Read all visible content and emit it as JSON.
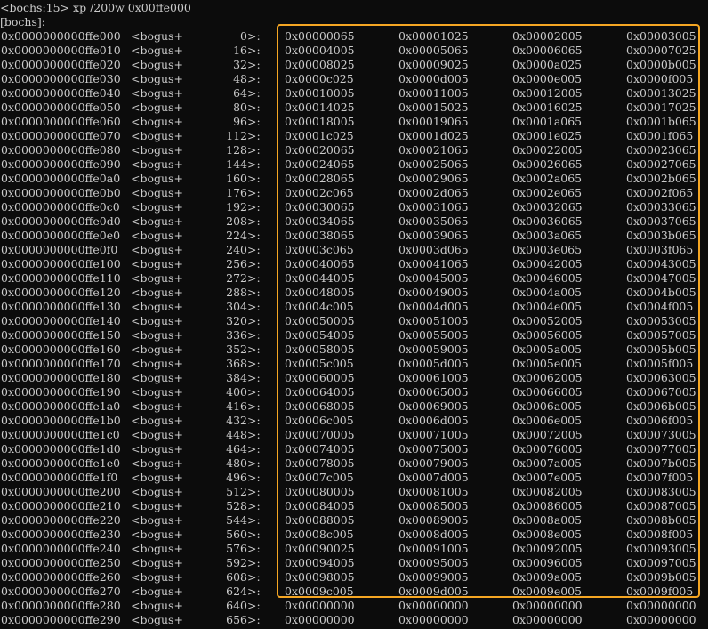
{
  "terminal": {
    "command_line": "<bochs:15> xp /200w 0x00ffe000",
    "prompt_line": "[bochs]:",
    "highlight_color": "#f5a623",
    "text_color": "#cccccc",
    "background_color": "#0c0c0c"
  },
  "rows": [
    {
      "addr": "0x0000000000ffe000",
      "sym": "<bogus+",
      "off": "0",
      "vals": [
        "0x00000065",
        "0x00001025",
        "0x00002005",
        "0x00003005"
      ]
    },
    {
      "addr": "0x0000000000ffe010",
      "sym": "<bogus+",
      "off": "16",
      "vals": [
        "0x00004005",
        "0x00005065",
        "0x00006065",
        "0x00007025"
      ]
    },
    {
      "addr": "0x0000000000ffe020",
      "sym": "<bogus+",
      "off": "32",
      "vals": [
        "0x00008025",
        "0x00009025",
        "0x0000a025",
        "0x0000b005"
      ]
    },
    {
      "addr": "0x0000000000ffe030",
      "sym": "<bogus+",
      "off": "48",
      "vals": [
        "0x0000c025",
        "0x0000d005",
        "0x0000e005",
        "0x0000f005"
      ]
    },
    {
      "addr": "0x0000000000ffe040",
      "sym": "<bogus+",
      "off": "64",
      "vals": [
        "0x00010005",
        "0x00011005",
        "0x00012005",
        "0x00013025"
      ]
    },
    {
      "addr": "0x0000000000ffe050",
      "sym": "<bogus+",
      "off": "80",
      "vals": [
        "0x00014025",
        "0x00015025",
        "0x00016025",
        "0x00017025"
      ]
    },
    {
      "addr": "0x0000000000ffe060",
      "sym": "<bogus+",
      "off": "96",
      "vals": [
        "0x00018005",
        "0x00019065",
        "0x0001a065",
        "0x0001b065"
      ]
    },
    {
      "addr": "0x0000000000ffe070",
      "sym": "<bogus+",
      "off": "112",
      "vals": [
        "0x0001c025",
        "0x0001d025",
        "0x0001e025",
        "0x0001f065"
      ]
    },
    {
      "addr": "0x0000000000ffe080",
      "sym": "<bogus+",
      "off": "128",
      "vals": [
        "0x00020065",
        "0x00021065",
        "0x00022005",
        "0x00023065"
      ]
    },
    {
      "addr": "0x0000000000ffe090",
      "sym": "<bogus+",
      "off": "144",
      "vals": [
        "0x00024065",
        "0x00025065",
        "0x00026065",
        "0x00027065"
      ]
    },
    {
      "addr": "0x0000000000ffe0a0",
      "sym": "<bogus+",
      "off": "160",
      "vals": [
        "0x00028065",
        "0x00029065",
        "0x0002a065",
        "0x0002b065"
      ]
    },
    {
      "addr": "0x0000000000ffe0b0",
      "sym": "<bogus+",
      "off": "176",
      "vals": [
        "0x0002c065",
        "0x0002d065",
        "0x0002e065",
        "0x0002f065"
      ]
    },
    {
      "addr": "0x0000000000ffe0c0",
      "sym": "<bogus+",
      "off": "192",
      "vals": [
        "0x00030065",
        "0x00031065",
        "0x00032065",
        "0x00033065"
      ]
    },
    {
      "addr": "0x0000000000ffe0d0",
      "sym": "<bogus+",
      "off": "208",
      "vals": [
        "0x00034065",
        "0x00035065",
        "0x00036065",
        "0x00037065"
      ]
    },
    {
      "addr": "0x0000000000ffe0e0",
      "sym": "<bogus+",
      "off": "224",
      "vals": [
        "0x00038065",
        "0x00039065",
        "0x0003a065",
        "0x0003b065"
      ]
    },
    {
      "addr": "0x0000000000ffe0f0",
      "sym": "<bogus+",
      "off": "240",
      "vals": [
        "0x0003c065",
        "0x0003d065",
        "0x0003e065",
        "0x0003f065"
      ]
    },
    {
      "addr": "0x0000000000ffe100",
      "sym": "<bogus+",
      "off": "256",
      "vals": [
        "0x00040065",
        "0x00041065",
        "0x00042005",
        "0x00043005"
      ]
    },
    {
      "addr": "0x0000000000ffe110",
      "sym": "<bogus+",
      "off": "272",
      "vals": [
        "0x00044005",
        "0x00045005",
        "0x00046005",
        "0x00047005"
      ]
    },
    {
      "addr": "0x0000000000ffe120",
      "sym": "<bogus+",
      "off": "288",
      "vals": [
        "0x00048005",
        "0x00049005",
        "0x0004a005",
        "0x0004b005"
      ]
    },
    {
      "addr": "0x0000000000ffe130",
      "sym": "<bogus+",
      "off": "304",
      "vals": [
        "0x0004c005",
        "0x0004d005",
        "0x0004e005",
        "0x0004f005"
      ]
    },
    {
      "addr": "0x0000000000ffe140",
      "sym": "<bogus+",
      "off": "320",
      "vals": [
        "0x00050005",
        "0x00051005",
        "0x00052005",
        "0x00053005"
      ]
    },
    {
      "addr": "0x0000000000ffe150",
      "sym": "<bogus+",
      "off": "336",
      "vals": [
        "0x00054005",
        "0x00055005",
        "0x00056005",
        "0x00057005"
      ]
    },
    {
      "addr": "0x0000000000ffe160",
      "sym": "<bogus+",
      "off": "352",
      "vals": [
        "0x00058005",
        "0x00059005",
        "0x0005a005",
        "0x0005b005"
      ]
    },
    {
      "addr": "0x0000000000ffe170",
      "sym": "<bogus+",
      "off": "368",
      "vals": [
        "0x0005c005",
        "0x0005d005",
        "0x0005e005",
        "0x0005f005"
      ]
    },
    {
      "addr": "0x0000000000ffe180",
      "sym": "<bogus+",
      "off": "384",
      "vals": [
        "0x00060005",
        "0x00061005",
        "0x00062005",
        "0x00063005"
      ]
    },
    {
      "addr": "0x0000000000ffe190",
      "sym": "<bogus+",
      "off": "400",
      "vals": [
        "0x00064005",
        "0x00065005",
        "0x00066005",
        "0x00067005"
      ]
    },
    {
      "addr": "0x0000000000ffe1a0",
      "sym": "<bogus+",
      "off": "416",
      "vals": [
        "0x00068005",
        "0x00069005",
        "0x0006a005",
        "0x0006b005"
      ]
    },
    {
      "addr": "0x0000000000ffe1b0",
      "sym": "<bogus+",
      "off": "432",
      "vals": [
        "0x0006c005",
        "0x0006d005",
        "0x0006e005",
        "0x0006f005"
      ]
    },
    {
      "addr": "0x0000000000ffe1c0",
      "sym": "<bogus+",
      "off": "448",
      "vals": [
        "0x00070005",
        "0x00071005",
        "0x00072005",
        "0x00073005"
      ]
    },
    {
      "addr": "0x0000000000ffe1d0",
      "sym": "<bogus+",
      "off": "464",
      "vals": [
        "0x00074005",
        "0x00075005",
        "0x00076005",
        "0x00077005"
      ]
    },
    {
      "addr": "0x0000000000ffe1e0",
      "sym": "<bogus+",
      "off": "480",
      "vals": [
        "0x00078005",
        "0x00079005",
        "0x0007a005",
        "0x0007b005"
      ]
    },
    {
      "addr": "0x0000000000ffe1f0",
      "sym": "<bogus+",
      "off": "496",
      "vals": [
        "0x0007c005",
        "0x0007d005",
        "0x0007e005",
        "0x0007f005"
      ]
    },
    {
      "addr": "0x0000000000ffe200",
      "sym": "<bogus+",
      "off": "512",
      "vals": [
        "0x00080005",
        "0x00081005",
        "0x00082005",
        "0x00083005"
      ]
    },
    {
      "addr": "0x0000000000ffe210",
      "sym": "<bogus+",
      "off": "528",
      "vals": [
        "0x00084005",
        "0x00085005",
        "0x00086005",
        "0x00087005"
      ]
    },
    {
      "addr": "0x0000000000ffe220",
      "sym": "<bogus+",
      "off": "544",
      "vals": [
        "0x00088005",
        "0x00089005",
        "0x0008a005",
        "0x0008b005"
      ]
    },
    {
      "addr": "0x0000000000ffe230",
      "sym": "<bogus+",
      "off": "560",
      "vals": [
        "0x0008c005",
        "0x0008d005",
        "0x0008e005",
        "0x0008f005"
      ]
    },
    {
      "addr": "0x0000000000ffe240",
      "sym": "<bogus+",
      "off": "576",
      "vals": [
        "0x00090025",
        "0x00091005",
        "0x00092005",
        "0x00093005"
      ]
    },
    {
      "addr": "0x0000000000ffe250",
      "sym": "<bogus+",
      "off": "592",
      "vals": [
        "0x00094005",
        "0x00095005",
        "0x00096005",
        "0x00097005"
      ]
    },
    {
      "addr": "0x0000000000ffe260",
      "sym": "<bogus+",
      "off": "608",
      "vals": [
        "0x00098005",
        "0x00099005",
        "0x0009a005",
        "0x0009b005"
      ]
    },
    {
      "addr": "0x0000000000ffe270",
      "sym": "<bogus+",
      "off": "624",
      "vals": [
        "0x0009c005",
        "0x0009d005",
        "0x0009e005",
        "0x0009f005"
      ]
    },
    {
      "addr": "0x0000000000ffe280",
      "sym": "<bogus+",
      "off": "640",
      "vals": [
        "0x00000000",
        "0x00000000",
        "0x00000000",
        "0x00000000"
      ]
    },
    {
      "addr": "0x0000000000ffe290",
      "sym": "<bogus+",
      "off": "656",
      "vals": [
        "0x00000000",
        "0x00000000",
        "0x00000000",
        "0x00000000"
      ]
    }
  ]
}
